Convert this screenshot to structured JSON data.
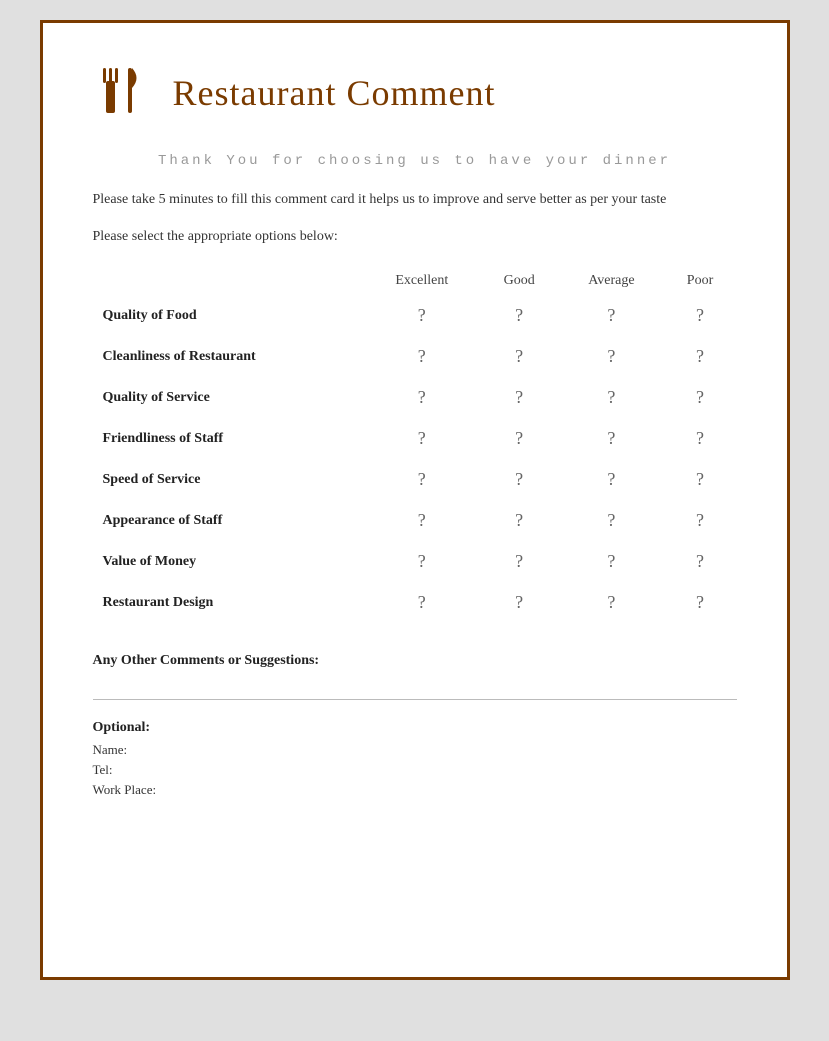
{
  "header": {
    "title": "Restaurant Comment"
  },
  "thank_you": "Thank You for choosing us to have your dinner",
  "description": "Please take 5 minutes to fill this comment card it helps us to improve and serve better as per your taste",
  "instruction": "Please select the appropriate options below:",
  "table": {
    "columns": [
      "",
      "Excellent",
      "Good",
      "Average",
      "Poor"
    ],
    "rows": [
      {
        "label": "Quality of Food",
        "values": [
          "?",
          "?",
          "?",
          "?"
        ]
      },
      {
        "label": "Cleanliness of Restaurant",
        "values": [
          "?",
          "?",
          "?",
          "?"
        ]
      },
      {
        "label": "Quality of Service",
        "values": [
          "?",
          "?",
          "?",
          "?"
        ]
      },
      {
        "label": "Friendliness of Staff",
        "values": [
          "?",
          "?",
          "?",
          "?"
        ]
      },
      {
        "label": "Speed of Service",
        "values": [
          "?",
          "?",
          "?",
          "?"
        ]
      },
      {
        "label": "Appearance of Staff",
        "values": [
          "?",
          "?",
          "?",
          "?"
        ]
      },
      {
        "label": "Value of Money",
        "values": [
          "?",
          "?",
          "?",
          "?"
        ]
      },
      {
        "label": "Restaurant Design",
        "values": [
          "?",
          "?",
          "?",
          "?"
        ]
      }
    ]
  },
  "comments": {
    "label": "Any Other Comments or Suggestions:"
  },
  "optional": {
    "title": "Optional:",
    "fields": [
      "Name:",
      "Tel:",
      "Work Place:"
    ]
  }
}
